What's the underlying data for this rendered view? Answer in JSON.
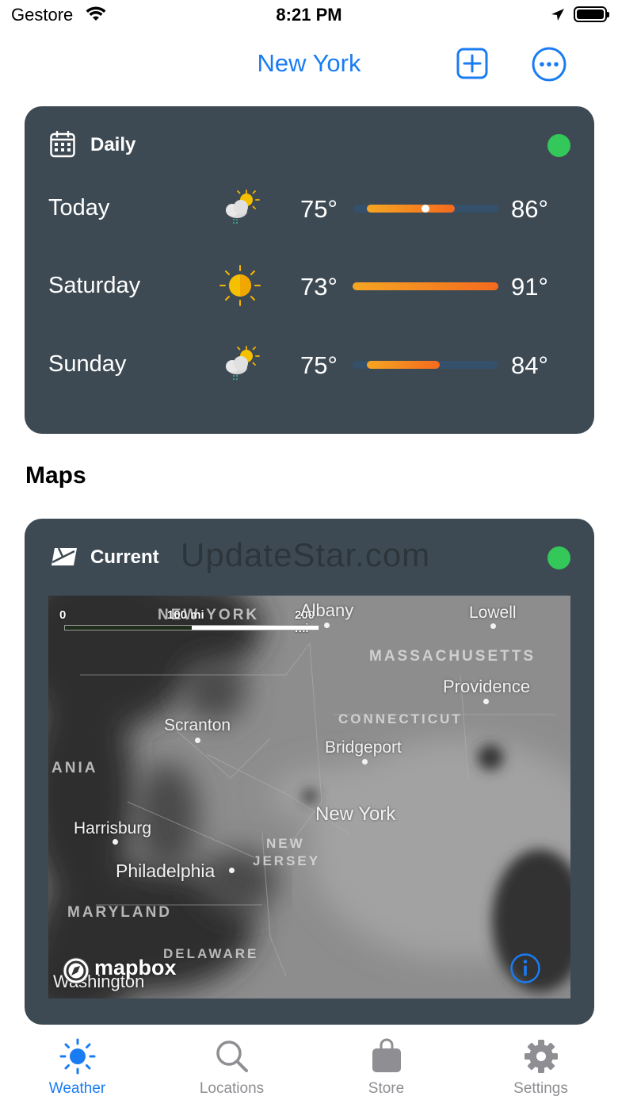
{
  "status_bar": {
    "carrier": "Gestore",
    "time": "8:21 PM"
  },
  "nav": {
    "title": "New York"
  },
  "daily": {
    "title": "Daily",
    "rows": [
      {
        "day": "Today",
        "low": "75°",
        "high": "86°",
        "icon": "partly-cloudy-rain-icon",
        "bar_start": 0.1,
        "bar_end": 0.7,
        "current": 0.5
      },
      {
        "day": "Saturday",
        "low": "73°",
        "high": "91°",
        "icon": "sun-icon",
        "bar_start": 0.0,
        "bar_end": 1.0,
        "current": null
      },
      {
        "day": "Sunday",
        "low": "75°",
        "high": "84°",
        "icon": "partly-cloudy-rain-icon",
        "bar_start": 0.1,
        "bar_end": 0.6,
        "current": null
      }
    ]
  },
  "maps": {
    "section_title": "Maps",
    "card_title": "Current",
    "watermark": "UpdateStar.com",
    "scale": {
      "zero": "0",
      "mid": "100 mi",
      "end": "200 mi"
    },
    "cities": {
      "albany": "Albany",
      "lowell": "Lowell",
      "providence": "Providence",
      "scranton": "Scranton",
      "bridgeport": "Bridgeport",
      "new_york": "New York",
      "harrisburg": "Harrisburg",
      "philadelphia": "Philadelphia",
      "washington": "Washington"
    },
    "regions": {
      "new_york": "NEW YORK",
      "massachusetts": "MASSACHUSETTS",
      "connecticut": "CONNECTICUT",
      "pennsylvania": "ANIA",
      "new_jersey_1": "NEW",
      "new_jersey_2": "JERSEY",
      "maryland": "MARYLAND",
      "delaware": "DELAWARE"
    },
    "attribution": "mapbox"
  },
  "tabs": [
    {
      "label": "Weather",
      "icon": "sun-icon",
      "active": true
    },
    {
      "label": "Locations",
      "icon": "search-icon",
      "active": false
    },
    {
      "label": "Store",
      "icon": "shopping-bag-icon",
      "active": false
    },
    {
      "label": "Settings",
      "icon": "gear-icon",
      "active": false
    }
  ],
  "colors": {
    "accent": "#1a7cf2",
    "card": "#3e4a53",
    "status_ok": "#34c759"
  }
}
